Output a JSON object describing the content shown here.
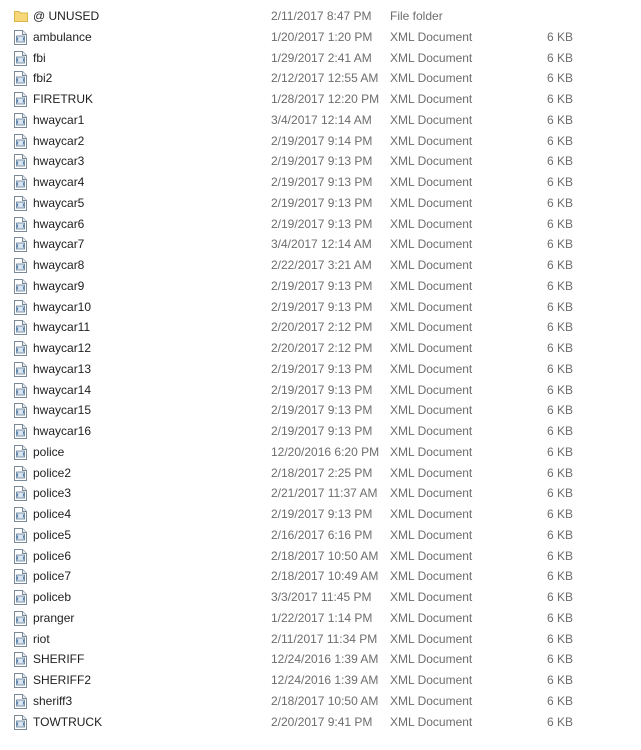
{
  "colors": {
    "folder": "#f7d777",
    "xml_icon_border": "#7a8a99",
    "xml_icon_fill": "#ffffff",
    "text": "#1e1e1e",
    "secondary_text": "#6d6d6d"
  },
  "files": [
    {
      "name": "@ UNUSED",
      "date": "2/11/2017 8:47 PM",
      "type": "File folder",
      "size": "",
      "icon": "folder-icon"
    },
    {
      "name": "ambulance",
      "date": "1/20/2017 1:20 PM",
      "type": "XML Document",
      "size": "6 KB",
      "icon": "xml-document-icon"
    },
    {
      "name": "fbi",
      "date": "1/29/2017 2:41 AM",
      "type": "XML Document",
      "size": "6 KB",
      "icon": "xml-document-icon"
    },
    {
      "name": "fbi2",
      "date": "2/12/2017 12:55 AM",
      "type": "XML Document",
      "size": "6 KB",
      "icon": "xml-document-icon"
    },
    {
      "name": "FIRETRUK",
      "date": "1/28/2017 12:20 PM",
      "type": "XML Document",
      "size": "6 KB",
      "icon": "xml-document-icon"
    },
    {
      "name": "hwaycar1",
      "date": "3/4/2017 12:14 AM",
      "type": "XML Document",
      "size": "6 KB",
      "icon": "xml-document-icon"
    },
    {
      "name": "hwaycar2",
      "date": "2/19/2017 9:14 PM",
      "type": "XML Document",
      "size": "6 KB",
      "icon": "xml-document-icon"
    },
    {
      "name": "hwaycar3",
      "date": "2/19/2017 9:13 PM",
      "type": "XML Document",
      "size": "6 KB",
      "icon": "xml-document-icon"
    },
    {
      "name": "hwaycar4",
      "date": "2/19/2017 9:13 PM",
      "type": "XML Document",
      "size": "6 KB",
      "icon": "xml-document-icon"
    },
    {
      "name": "hwaycar5",
      "date": "2/19/2017 9:13 PM",
      "type": "XML Document",
      "size": "6 KB",
      "icon": "xml-document-icon"
    },
    {
      "name": "hwaycar6",
      "date": "2/19/2017 9:13 PM",
      "type": "XML Document",
      "size": "6 KB",
      "icon": "xml-document-icon"
    },
    {
      "name": "hwaycar7",
      "date": "3/4/2017 12:14 AM",
      "type": "XML Document",
      "size": "6 KB",
      "icon": "xml-document-icon"
    },
    {
      "name": "hwaycar8",
      "date": "2/22/2017 3:21 AM",
      "type": "XML Document",
      "size": "6 KB",
      "icon": "xml-document-icon"
    },
    {
      "name": "hwaycar9",
      "date": "2/19/2017 9:13 PM",
      "type": "XML Document",
      "size": "6 KB",
      "icon": "xml-document-icon"
    },
    {
      "name": "hwaycar10",
      "date": "2/19/2017 9:13 PM",
      "type": "XML Document",
      "size": "6 KB",
      "icon": "xml-document-icon"
    },
    {
      "name": "hwaycar11",
      "date": "2/20/2017 2:12 PM",
      "type": "XML Document",
      "size": "6 KB",
      "icon": "xml-document-icon"
    },
    {
      "name": "hwaycar12",
      "date": "2/20/2017 2:12 PM",
      "type": "XML Document",
      "size": "6 KB",
      "icon": "xml-document-icon"
    },
    {
      "name": "hwaycar13",
      "date": "2/19/2017 9:13 PM",
      "type": "XML Document",
      "size": "6 KB",
      "icon": "xml-document-icon"
    },
    {
      "name": "hwaycar14",
      "date": "2/19/2017 9:13 PM",
      "type": "XML Document",
      "size": "6 KB",
      "icon": "xml-document-icon"
    },
    {
      "name": "hwaycar15",
      "date": "2/19/2017 9:13 PM",
      "type": "XML Document",
      "size": "6 KB",
      "icon": "xml-document-icon"
    },
    {
      "name": "hwaycar16",
      "date": "2/19/2017 9:13 PM",
      "type": "XML Document",
      "size": "6 KB",
      "icon": "xml-document-icon"
    },
    {
      "name": "police",
      "date": "12/20/2016 6:20 PM",
      "type": "XML Document",
      "size": "6 KB",
      "icon": "xml-document-icon"
    },
    {
      "name": "police2",
      "date": "2/18/2017 2:25 PM",
      "type": "XML Document",
      "size": "6 KB",
      "icon": "xml-document-icon"
    },
    {
      "name": "police3",
      "date": "2/21/2017 11:37 AM",
      "type": "XML Document",
      "size": "6 KB",
      "icon": "xml-document-icon"
    },
    {
      "name": "police4",
      "date": "2/19/2017 9:13 PM",
      "type": "XML Document",
      "size": "6 KB",
      "icon": "xml-document-icon"
    },
    {
      "name": "police5",
      "date": "2/16/2017 6:16 PM",
      "type": "XML Document",
      "size": "6 KB",
      "icon": "xml-document-icon"
    },
    {
      "name": "police6",
      "date": "2/18/2017 10:50 AM",
      "type": "XML Document",
      "size": "6 KB",
      "icon": "xml-document-icon"
    },
    {
      "name": "police7",
      "date": "2/18/2017 10:49 AM",
      "type": "XML Document",
      "size": "6 KB",
      "icon": "xml-document-icon"
    },
    {
      "name": "policeb",
      "date": "3/3/2017 11:45 PM",
      "type": "XML Document",
      "size": "6 KB",
      "icon": "xml-document-icon"
    },
    {
      "name": "pranger",
      "date": "1/22/2017 1:14 PM",
      "type": "XML Document",
      "size": "6 KB",
      "icon": "xml-document-icon"
    },
    {
      "name": "riot",
      "date": "2/11/2017 11:34 PM",
      "type": "XML Document",
      "size": "6 KB",
      "icon": "xml-document-icon"
    },
    {
      "name": "SHERIFF",
      "date": "12/24/2016 1:39 AM",
      "type": "XML Document",
      "size": "6 KB",
      "icon": "xml-document-icon"
    },
    {
      "name": "SHERIFF2",
      "date": "12/24/2016 1:39 AM",
      "type": "XML Document",
      "size": "6 KB",
      "icon": "xml-document-icon"
    },
    {
      "name": "sheriff3",
      "date": "2/18/2017 10:50 AM",
      "type": "XML Document",
      "size": "6 KB",
      "icon": "xml-document-icon"
    },
    {
      "name": "TOWTRUCK",
      "date": "2/20/2017 9:41 PM",
      "type": "XML Document",
      "size": "6 KB",
      "icon": "xml-document-icon"
    }
  ]
}
